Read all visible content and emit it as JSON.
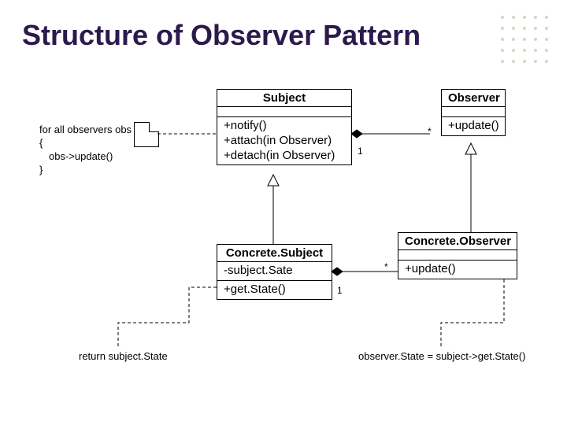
{
  "title": "Structure of Observer Pattern",
  "classes": {
    "subject": {
      "name": "Subject",
      "ops": [
        "+notify()",
        "+attach(in Observer)",
        "+detach(in Observer)"
      ]
    },
    "observer": {
      "name": "Observer",
      "ops": [
        "+update()"
      ]
    },
    "concreteSubject": {
      "name": "Concrete.Subject",
      "attrs": [
        "-subject.Sate"
      ],
      "ops": [
        "+get.State()"
      ]
    },
    "concreteObserver": {
      "name": "Concrete.Observer",
      "ops": [
        "+update()"
      ]
    }
  },
  "notes": {
    "notifyBody": {
      "lines": [
        "for all observers obs",
        "{",
        "  obs->update()",
        "}"
      ]
    },
    "getStateBody": "return subject.State",
    "updateBody": "observer.State = subject->get.State()"
  },
  "assoc": {
    "subjObs": {
      "left": "1",
      "right": "*"
    },
    "csubCobs": {
      "left": "1",
      "right": "*"
    }
  }
}
